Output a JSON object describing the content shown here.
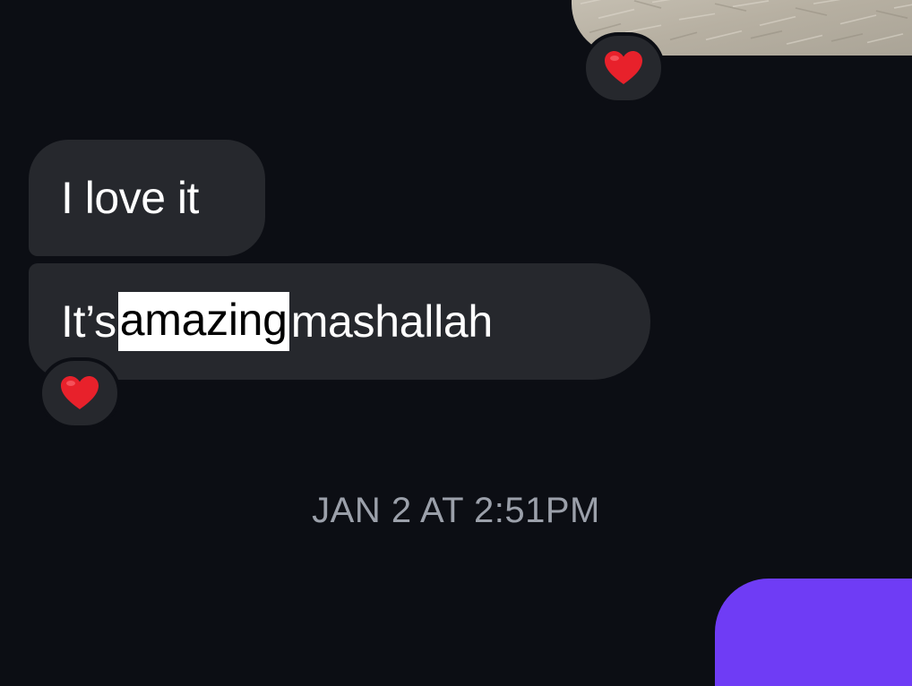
{
  "messages": [
    {
      "text": "I love it"
    },
    {
      "text_before": "It’s",
      "selected_text": "amazing",
      "text_after": "mashallah"
    }
  ],
  "reactions": {
    "photo": "heart-icon",
    "message_2": "heart-icon"
  },
  "timestamp": "JAN 2 AT 2:51PM",
  "colors": {
    "background": "#0c0e14",
    "bubble": "#26282d",
    "heart": "#e8212b",
    "timestamp": "#9ba0aa",
    "outgoing_bubble": "#6f3cf5",
    "selection": "#ffffff"
  }
}
